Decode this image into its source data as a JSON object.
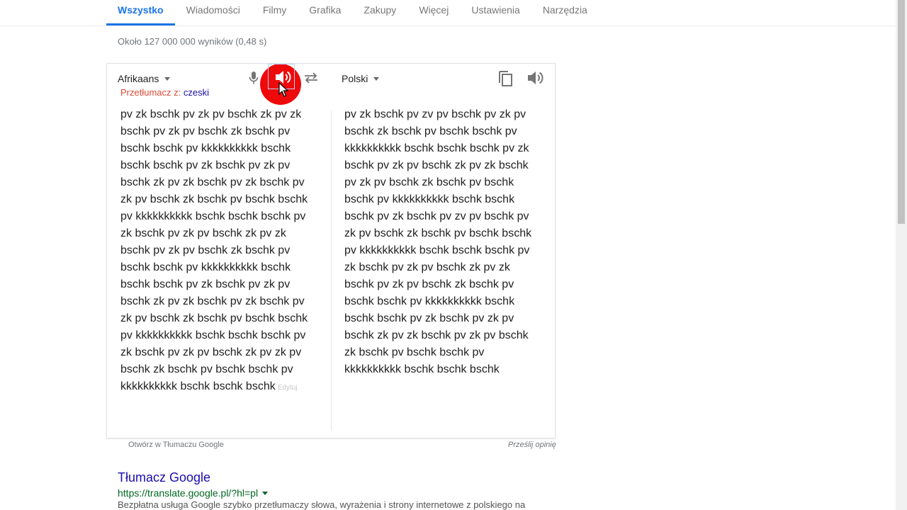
{
  "tabs": [
    {
      "label": "Wszystko",
      "active": true
    },
    {
      "label": "Wiadomości"
    },
    {
      "label": "Filmy"
    },
    {
      "label": "Grafika"
    },
    {
      "label": "Zakupy"
    },
    {
      "label": "Więcej"
    },
    {
      "label": "Ustawienia"
    },
    {
      "label": "Narzędzia"
    }
  ],
  "result_stats": "Około 127 000 000 wyników (0,48 s)",
  "translator": {
    "source_lang": "Afrikaans",
    "detected_prefix": "Przetłumacz z:",
    "detected_lang": "czeski",
    "target_lang": "Polski",
    "source_text": "pv zk bschk pv zk pv bschk zk pv zk bschk pv zk pv bschk zk bschk pv bschk bschk pv kkkkkkkkkk bschk bschk bschk pv zk bschk pv zk pv bschk zk pv zk bschk pv zk bschk pv zk pv bschk zk bschk pv bschk bschk pv kkkkkkkkkk bschk bschk bschk pv zk bschk pv zk pv bschk zk pv zk bschk pv zk pv bschk zk bschk pv bschk bschk pv kkkkkkkkkk bschk bschk bschk pv zk bschk pv zk pv bschk zk pv zk bschk pv zk bschk pv zk pv bschk zk bschk pv bschk bschk pv kkkkkkkkkk bschk bschk bschk pv zk bschk pv zk pv bschk zk pv zk pv bschk zk bschk pv bschk bschk pv kkkkkkkkkk bschk bschk bschk",
    "edit_label": "Edytuj",
    "translated_text": "pv zk bschk pv zv pv bschk pv zk pv bschk zk bschk pv bschk bschk pv kkkkkkkkkk bschk bschk bschk pv zk bschk pv zk pv bschk zk pv zk bschk pv zk pv bschk zk bschk pv bschk bschk pv kkkkkkkkkk bschk bschk bschk pv zk bschk pv zv pv bschk pv zk pv bschk zk bschk pv bschk bschk pv kkkkkkkkkk bschk bschk bschk pv zk bschk pv zk pv bschk zk pv zk bschk pv zk pv bschk zk bschk pv bschk bschk pv kkkkkkkkkk bschk bschk bschk pv zk bschk pv zk pv bschk zk pv zk bschk pv zk pv bschk zk bschk pv bschk bschk pv kkkkkkkkkk bschk bschk bschk",
    "open_link": "Otwórz w Tłumaczu Google",
    "feedback_link": "Prześlij opinię",
    "colors": {
      "highlight": "#ee0a0a",
      "link": "#1a0dab",
      "accent": "#1a73e8"
    }
  },
  "result": {
    "title": "Tłumacz Google",
    "url": "https://translate.google.pl/?hl=pl",
    "snippet": "Bezpłatna usługa Google szybko przetłumaczy słowa, wyrażenia i strony internetowe z polskiego na"
  }
}
